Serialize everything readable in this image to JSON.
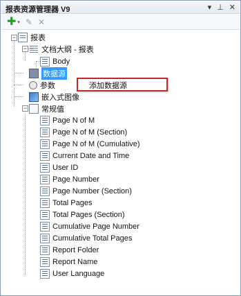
{
  "window": {
    "title": "报表资源管理器 V9",
    "icons": [
      "▾",
      "⊥",
      "✕"
    ]
  },
  "toolbar": {
    "add_glyph": "✚",
    "dropdown_glyph": "▾",
    "edit_glyph": "✎",
    "delete_glyph": "✕"
  },
  "tree": {
    "root": "报表",
    "outline": "文档大纲 - 报表",
    "body": "Body",
    "datasource": "数据源",
    "parameters": "参数",
    "embedded_images": "嵌入式图像",
    "common_values": "常规值",
    "common_items": [
      "Page N of M",
      "Page N of M (Section)",
      "Page N of M (Cumulative)",
      "Current Date and Time",
      "User ID",
      "Page Number",
      "Page Number (Section)",
      "Total Pages",
      "Total Pages (Section)",
      "Cumulative Page Number",
      "Cumulative Total Pages",
      "Report Folder",
      "Report Name",
      "User Language"
    ]
  },
  "context_menu": {
    "add_datasource": "添加数据源"
  },
  "colors": {
    "selection": "#3399ff",
    "highlight_border": "#c1272d",
    "add_icon": "#17a21f"
  }
}
